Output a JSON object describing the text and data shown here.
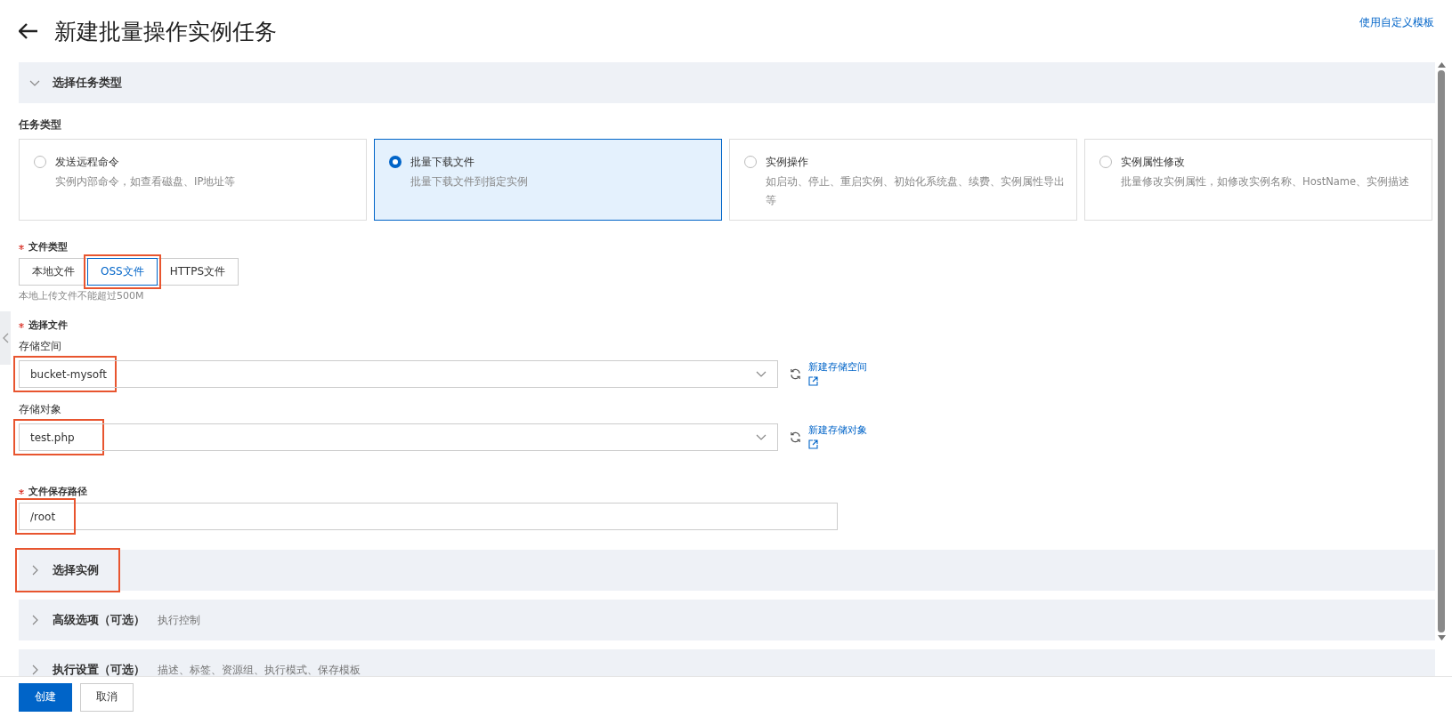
{
  "header": {
    "title": "新建批量操作实例任务",
    "template_link": "使用自定义模板"
  },
  "sections": [
    {
      "title": "选择任务类型",
      "expanded": true,
      "highlighted": false
    },
    {
      "title": "选择实例",
      "expanded": false,
      "highlighted": true
    },
    {
      "title": "高级选项（可选）",
      "subtitle": "执行控制",
      "expanded": false,
      "highlighted": false
    },
    {
      "title": "执行设置（可选）",
      "subtitle": "描述、标签、资源组、执行模式、保存模板",
      "expanded": false,
      "highlighted": false
    }
  ],
  "task_type": {
    "label": "任务类型",
    "options": [
      {
        "title": "发送远程命令",
        "description": "实例内部命令，如查看磁盘、IP地址等",
        "selected": false
      },
      {
        "title": "批量下载文件",
        "description": "批量下载文件到指定实例",
        "selected": true
      },
      {
        "title": "实例操作",
        "description": "如启动、停止、重启实例、初始化系统盘、续费、实例属性导出等",
        "selected": false
      },
      {
        "title": "实例属性修改",
        "description": "批量修改实例属性，如修改实例名称、HostName、实例描述",
        "selected": false
      }
    ]
  },
  "file_type": {
    "label": "文件类型",
    "required": true,
    "options": [
      {
        "label": "本地文件",
        "selected": false,
        "highlighted": false
      },
      {
        "label": "OSS文件",
        "selected": true,
        "highlighted": true
      },
      {
        "label": "HTTPS文件",
        "selected": false,
        "highlighted": false
      }
    ],
    "hint": "本地上传文件不能超过500M"
  },
  "select_file": {
    "label": "选择文件",
    "required": true,
    "fields": [
      {
        "label": "存储空间",
        "value": "bucket-mysoft",
        "highlighted": true,
        "link": "新建存储空间"
      },
      {
        "label": "存储对象",
        "value": "test.php",
        "highlighted": true,
        "link": "新建存储对象"
      }
    ]
  },
  "save_path": {
    "label": "文件保存路径",
    "required": true,
    "value": "/root",
    "highlighted": true
  },
  "buttons": [
    {
      "label": "创建",
      "kind": "primary"
    },
    {
      "label": "取消",
      "kind": "default"
    }
  ]
}
